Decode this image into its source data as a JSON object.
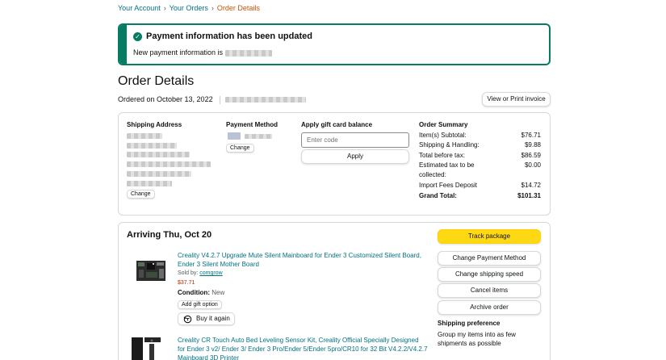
{
  "breadcrumb": {
    "your_account": "Your Account",
    "your_orders": "Your Orders",
    "current": "Order Details",
    "separator": "›"
  },
  "alert": {
    "title": "Payment information has been updated",
    "message": "New payment information is",
    "color": "#067d62"
  },
  "header": {
    "title": "Order Details",
    "ordered_on": "Ordered on October 13, 2022",
    "invoice_button": "View or Print invoice"
  },
  "summary_card": {
    "shipping_address_label": "Shipping Address",
    "shipping_change": "Change",
    "payment_method_label": "Payment Method",
    "payment_change": "Change",
    "gift_card_label": "Apply gift card balance",
    "gift_card_placeholder": "Enter code",
    "apply_button": "Apply"
  },
  "order_summary": {
    "title": "Order Summary",
    "rows": [
      {
        "label": "Item(s) Subtotal:",
        "value": "$76.71"
      },
      {
        "label": "Shipping & Handling:",
        "value": "$9.88"
      },
      {
        "label": "Total before tax:",
        "value": "$86.59"
      },
      {
        "label": "Estimated tax to be collected:",
        "value": "$0.00"
      },
      {
        "label": "Import Fees Deposit",
        "value": "$14.72"
      },
      {
        "label": "Grand Total:",
        "value": "$101.31"
      }
    ]
  },
  "shipment": {
    "arriving": "Arriving Thu, Oct 20",
    "items": [
      {
        "name": "Creality V4.2.7 Upgrade Mute Silent Mainboard for Ender 3 Customized Silent Board, Ender 3 Silent Mother Board",
        "sold_by_label": "Sold by:",
        "seller": "comgrow",
        "price": "$37.71",
        "condition_label": "Condition:",
        "condition": "New",
        "gift_option": "Add gift option",
        "buy_again": "Buy it again"
      },
      {
        "name": "Creality CR Touch Auto Bed Leveling Sensor Kit, Creality Official Specially Designed for Ender 3 v2/ Ender 3/ Ender 3 Pro/Ender 5/Ender 5pro/CR10 for 32 Bit V4.2.2/V4.2.7 Mainboard 3D Printer"
      }
    ],
    "actions": {
      "track": "Track package",
      "change_payment": "Change Payment Method",
      "change_speed": "Change shipping speed",
      "cancel": "Cancel items",
      "archive": "Archive order"
    },
    "shipping_preference_title": "Shipping preference",
    "shipping_preference_text": "Group my items into as few shipments as possible"
  },
  "colors": {
    "link": "#007185",
    "breadcrumb_current": "#c45500",
    "price": "#b12704",
    "track_button": "#ffd814"
  }
}
